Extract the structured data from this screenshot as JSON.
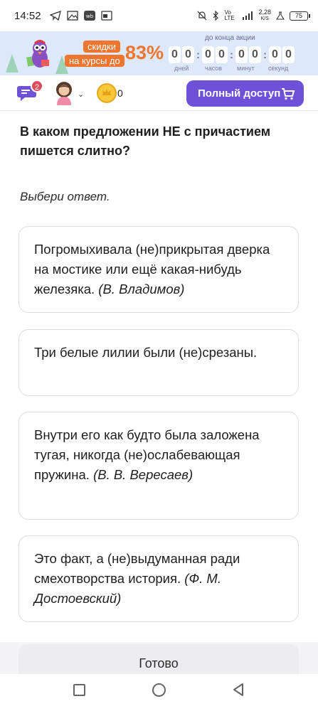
{
  "status_bar": {
    "time": "14:52",
    "network_speed": "2,28",
    "network_unit": "K/S",
    "battery": "75",
    "signal_label": "Vo LTE"
  },
  "promo": {
    "pill_top": "скидки",
    "pill_bottom": "на курсы до",
    "percent": "83%",
    "until_label": "до конца акции",
    "timer": {
      "days": [
        "0",
        "0"
      ],
      "hours": [
        "0",
        "0"
      ],
      "minutes": [
        "0",
        "0"
      ],
      "seconds": [
        "0",
        "0"
      ]
    },
    "labels": {
      "days": "дней",
      "hours": "часов",
      "minutes": "минут",
      "seconds": "секунд"
    }
  },
  "header": {
    "chat_badge": "2",
    "coins": "0",
    "full_access_label": "Полный доступ"
  },
  "question": "В каком предложении НЕ с причастием пишется слитно?",
  "hint": "Выбери ответ.",
  "options": [
    {
      "text": "Погромыхивала (не)прикрытая дверка на мостике или ещё какая-нибудь железяка.",
      "author": "(В. Владимов)"
    },
    {
      "text": "Три белые лилии были (не)срезаны.",
      "author": ""
    },
    {
      "text": "Внутри его как будто была заложена тугая, никогда (не)ослабевающая пружина.",
      "author": "(В. В. Вересаев)"
    },
    {
      "text": "Это факт, а (не)выдуманная ради смехотворства история.",
      "author": "(Ф. М. Достоевский)"
    }
  ],
  "done_label": "Готово",
  "colors": {
    "accent": "#6d52d8",
    "promo_orange": "#f0762f",
    "badge": "#e24b5b",
    "promo_bg": "#dde8fb"
  }
}
